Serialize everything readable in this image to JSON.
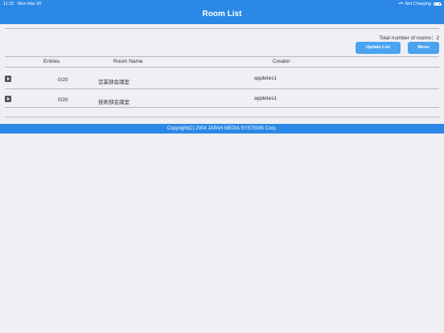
{
  "status_bar": {
    "time": "11:32",
    "date": "Mon Mar 30",
    "charging": "Not Charging"
  },
  "header": {
    "title": "Room List"
  },
  "summary": {
    "total_label": "Total number of rooms：2"
  },
  "toolbar": {
    "update_label": "Update List",
    "menu_label": "Menu"
  },
  "table": {
    "columns": [
      "Entries",
      "Room Name",
      "Creator"
    ],
    "rows": [
      {
        "entries": "0/20",
        "room_name": "営業部会議室",
        "creator": "appletes1"
      },
      {
        "entries": "0/20",
        "room_name": "技術部会議室",
        "creator": "appletes1"
      }
    ]
  },
  "footer": {
    "copyright": "Copyright(C) 2004 JAPAN MEDIA SYSTEMS Corp."
  },
  "colors": {
    "accent": "#2b88e6",
    "button": "#4aa3f0",
    "background": "#efeff4"
  },
  "icons": {
    "row_icon": "play-icon",
    "wifi": "wifi-icon",
    "battery": "battery-icon"
  }
}
